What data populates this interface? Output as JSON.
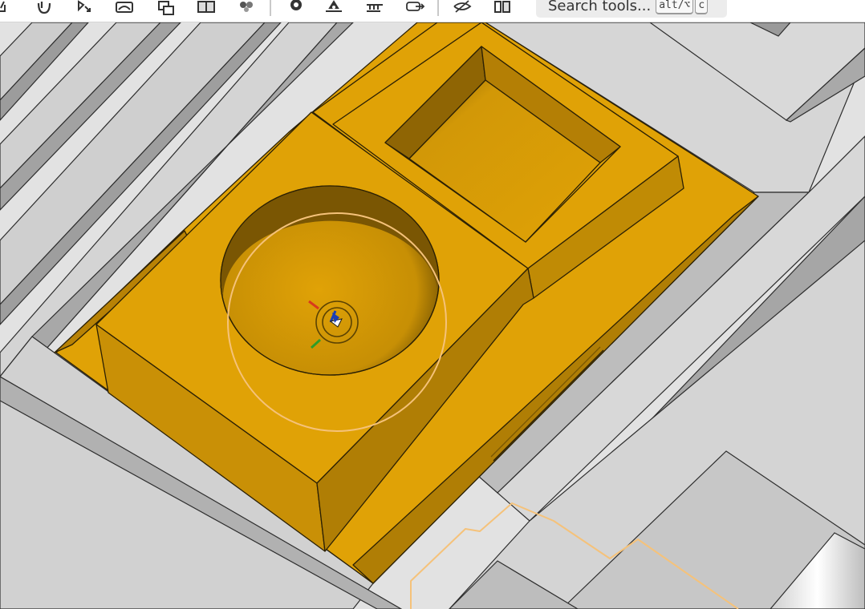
{
  "toolbar": {
    "tools": [
      {
        "name": "sketch-tool-icon"
      },
      {
        "name": "revolve-tool-icon"
      },
      {
        "name": "select-tool-icon"
      },
      {
        "name": "shell-tool-icon"
      },
      {
        "name": "transform-tool-icon"
      },
      {
        "name": "boolean-tool-icon"
      },
      {
        "name": "pattern-tool-icon"
      },
      {
        "name": "settings-gear-icon"
      },
      {
        "name": "mate-connector-icon"
      },
      {
        "name": "measure-tool-icon"
      },
      {
        "name": "export-tool-icon"
      },
      {
        "name": "hide-view-icon"
      },
      {
        "name": "appearance-tool-icon"
      }
    ],
    "search": {
      "placeholder": "Search tools...",
      "shortcut_key1": "alt/⌥",
      "shortcut_key2": "c"
    }
  },
  "viewport": {
    "part_color": "#e0a206",
    "background_color": "#e2e2e2",
    "selection_color": "#f5c27a",
    "triad_colors": {
      "x": "#d83a1c",
      "y": "#2f9d28",
      "z": "#1b3fb5"
    }
  }
}
